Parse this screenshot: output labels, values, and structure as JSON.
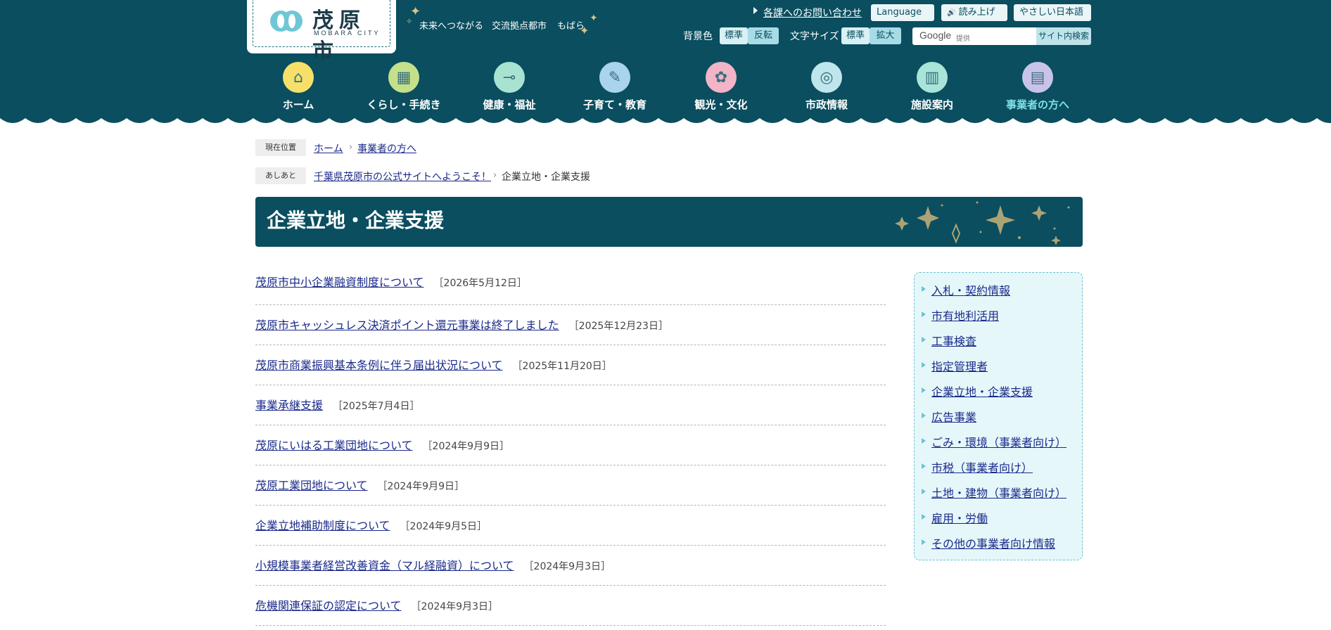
{
  "site": {
    "logo_title": "茂原市",
    "logo_sub": "MOBARA CITY",
    "taglines": [
      "未来へつながる",
      "交流拠点都市",
      "もばら"
    ]
  },
  "utility": {
    "contact": "各課へのお問い合わせ",
    "language": "Language",
    "read_aloud": "読み上げ",
    "easy_japanese": "やさしい日本語",
    "bg_color_label": "背景色",
    "bg_standard": "標準",
    "bg_invert": "反転",
    "font_size_label": "文字サイズ",
    "font_standard": "標準",
    "font_enlarge": "拡大",
    "search_brand": "Google",
    "search_provided": "提供",
    "search_button": "サイト内検索"
  },
  "nav": [
    {
      "label": "ホーム",
      "icon": "home-icon",
      "color": "#f6e06a"
    },
    {
      "label": "くらし・手続き",
      "icon": "house-form-icon",
      "color": "#c5e08a"
    },
    {
      "label": "健康・福祉",
      "icon": "thermometer-icon",
      "color": "#a8e3d2"
    },
    {
      "label": "子育て・教育",
      "icon": "pencil-icon",
      "color": "#a9d3ef"
    },
    {
      "label": "観光・文化",
      "icon": "flower-icon",
      "color": "#f2b4c6"
    },
    {
      "label": "市政情報",
      "icon": "city-emblem-icon",
      "color": "#bfe6ec"
    },
    {
      "label": "施設案内",
      "icon": "building-icon",
      "color": "#a9e4d8"
    },
    {
      "label": "事業者の方へ",
      "icon": "office-icon",
      "color": "#c9c3ea"
    }
  ],
  "breadcrumb": {
    "current_label": "現在位置",
    "items": [
      "ホーム",
      "事業者の方へ"
    ],
    "history_label": "あしあと",
    "history_link": "千葉県茂原市の公式サイトへようこそ！",
    "history_current": "企業立地・企業支援"
  },
  "page_title": "企業立地・企業支援",
  "news": [
    {
      "title": "茂原市中小企業融資制度について",
      "date": "［2026年5月12日］"
    },
    {
      "title": "茂原市キャッシュレス決済ポイント還元事業は終了しました",
      "date": "［2025年12月23日］"
    },
    {
      "title": "茂原市商業振興基本条例に伴う届出状況について",
      "date": "［2025年11月20日］"
    },
    {
      "title": "事業承継支援",
      "date": "［2025年7月4日］"
    },
    {
      "title": "茂原にいはる工業団地について",
      "date": "［2024年9月9日］"
    },
    {
      "title": "茂原工業団地について",
      "date": "［2024年9月9日］"
    },
    {
      "title": "企業立地補助制度について",
      "date": "［2024年9月5日］"
    },
    {
      "title": "小規模事業者経営改善資金（マル経融資）について",
      "date": "［2024年9月3日］"
    },
    {
      "title": "危機関連保証の認定について",
      "date": "［2024年9月3日］"
    }
  ],
  "side_menu": [
    "入札・契約情報",
    "市有地利活用",
    "工事検査",
    "指定管理者",
    "企業立地・企業支援",
    "広告事業",
    "ごみ・環境（事業者向け）",
    "市税（事業者向け）",
    "土地・建物（事業者向け）",
    "雇用・労働",
    "その他の事業者向け情報"
  ],
  "colors": {
    "header_bg": "#0a4e5f",
    "link": "#1a2a8a",
    "active_nav": "#7fe0ea",
    "side_bg": "#e6f7fa"
  }
}
